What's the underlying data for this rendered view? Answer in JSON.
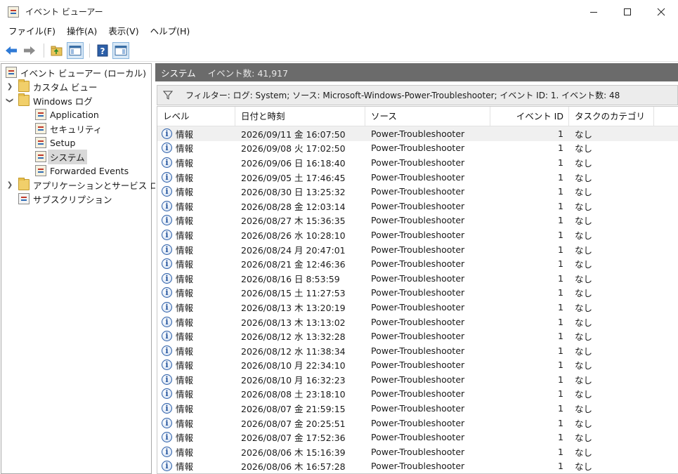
{
  "window": {
    "title": "イベント ビューアー",
    "controls": {
      "minimize": "—",
      "maximize": "☐",
      "close": "✕"
    }
  },
  "menu": [
    "ファイル(F)",
    "操作(A)",
    "表示(V)",
    "ヘルプ(H)"
  ],
  "toolbar": {
    "buttons": [
      "back-icon",
      "forward-icon",
      "folder-up-icon",
      "show-hide-tree-icon",
      "help-icon",
      "properties-icon"
    ],
    "colors": {
      "arrow": "#2f7ad6",
      "pressed_bg": "#d8e8f6"
    }
  },
  "tree": {
    "root": "イベント ビューアー (ローカル)",
    "custom_views": "カスタム ビュー",
    "windows_logs": "Windows ログ",
    "logs": [
      "Application",
      "セキュリティ",
      "Setup",
      "システム",
      "Forwarded Events"
    ],
    "app_service_logs": "アプリケーションとサービス ログ",
    "subscriptions": "サブスクリプション"
  },
  "main": {
    "header_title": "システム",
    "header_count": "イベント数: 41,917",
    "filter_text": "フィルター: ログ: System; ソース: Microsoft-Windows-Power-Troubleshooter; イベント ID: 1. イベント数: 48",
    "columns": [
      "レベル",
      "日付と時刻",
      "ソース",
      "イベント ID",
      "タスクのカテゴリ"
    ],
    "rows": [
      {
        "level": "情報",
        "datetime": "2026/09/11 金 16:07:50",
        "source": "Power-Troubleshooter",
        "id": "1",
        "category": "なし"
      },
      {
        "level": "情報",
        "datetime": "2026/09/08 火 17:02:50",
        "source": "Power-Troubleshooter",
        "id": "1",
        "category": "なし"
      },
      {
        "level": "情報",
        "datetime": "2026/09/06 日 16:18:40",
        "source": "Power-Troubleshooter",
        "id": "1",
        "category": "なし"
      },
      {
        "level": "情報",
        "datetime": "2026/09/05 土 17:46:45",
        "source": "Power-Troubleshooter",
        "id": "1",
        "category": "なし"
      },
      {
        "level": "情報",
        "datetime": "2026/08/30 日 13:25:32",
        "source": "Power-Troubleshooter",
        "id": "1",
        "category": "なし"
      },
      {
        "level": "情報",
        "datetime": "2026/08/28 金 12:03:14",
        "source": "Power-Troubleshooter",
        "id": "1",
        "category": "なし"
      },
      {
        "level": "情報",
        "datetime": "2026/08/27 木 15:36:35",
        "source": "Power-Troubleshooter",
        "id": "1",
        "category": "なし"
      },
      {
        "level": "情報",
        "datetime": "2026/08/26 水 10:28:10",
        "source": "Power-Troubleshooter",
        "id": "1",
        "category": "なし"
      },
      {
        "level": "情報",
        "datetime": "2026/08/24 月 20:47:01",
        "source": "Power-Troubleshooter",
        "id": "1",
        "category": "なし"
      },
      {
        "level": "情報",
        "datetime": "2026/08/21 金 12:46:36",
        "source": "Power-Troubleshooter",
        "id": "1",
        "category": "なし"
      },
      {
        "level": "情報",
        "datetime": "2026/08/16 日 8:53:59",
        "source": "Power-Troubleshooter",
        "id": "1",
        "category": "なし"
      },
      {
        "level": "情報",
        "datetime": "2026/08/15 土 11:27:53",
        "source": "Power-Troubleshooter",
        "id": "1",
        "category": "なし"
      },
      {
        "level": "情報",
        "datetime": "2026/08/13 木 13:20:19",
        "source": "Power-Troubleshooter",
        "id": "1",
        "category": "なし"
      },
      {
        "level": "情報",
        "datetime": "2026/08/13 木 13:13:02",
        "source": "Power-Troubleshooter",
        "id": "1",
        "category": "なし"
      },
      {
        "level": "情報",
        "datetime": "2026/08/12 水 13:32:28",
        "source": "Power-Troubleshooter",
        "id": "1",
        "category": "なし"
      },
      {
        "level": "情報",
        "datetime": "2026/08/12 水 11:38:34",
        "source": "Power-Troubleshooter",
        "id": "1",
        "category": "なし"
      },
      {
        "level": "情報",
        "datetime": "2026/08/10 月 22:34:10",
        "source": "Power-Troubleshooter",
        "id": "1",
        "category": "なし"
      },
      {
        "level": "情報",
        "datetime": "2026/08/10 月 16:32:23",
        "source": "Power-Troubleshooter",
        "id": "1",
        "category": "なし"
      },
      {
        "level": "情報",
        "datetime": "2026/08/08 土 23:18:10",
        "source": "Power-Troubleshooter",
        "id": "1",
        "category": "なし"
      },
      {
        "level": "情報",
        "datetime": "2026/08/07 金 21:59:15",
        "source": "Power-Troubleshooter",
        "id": "1",
        "category": "なし"
      },
      {
        "level": "情報",
        "datetime": "2026/08/07 金 20:25:51",
        "source": "Power-Troubleshooter",
        "id": "1",
        "category": "なし"
      },
      {
        "level": "情報",
        "datetime": "2026/08/07 金 17:52:36",
        "source": "Power-Troubleshooter",
        "id": "1",
        "category": "なし"
      },
      {
        "level": "情報",
        "datetime": "2026/08/06 木 15:16:39",
        "source": "Power-Troubleshooter",
        "id": "1",
        "category": "なし"
      },
      {
        "level": "情報",
        "datetime": "2026/08/06 木 16:57:28",
        "source": "Power-Troubleshooter",
        "id": "1",
        "category": "なし"
      }
    ]
  }
}
